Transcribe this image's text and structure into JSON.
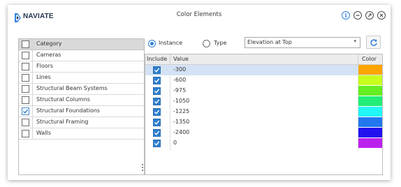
{
  "window": {
    "logo_text": "NAVIATE",
    "title": "Color Elements",
    "buttons": [
      "info",
      "minimize",
      "restore",
      "close"
    ]
  },
  "categories": {
    "header": "Category",
    "items": [
      {
        "label": "Cameras",
        "checked": false
      },
      {
        "label": "Floors",
        "checked": false
      },
      {
        "label": "Lines",
        "checked": false
      },
      {
        "label": "Structural Beam Systems",
        "checked": false
      },
      {
        "label": "Structural Columns",
        "checked": false
      },
      {
        "label": "Structural Foundations",
        "checked": true
      },
      {
        "label": "Structural Framing",
        "checked": false
      },
      {
        "label": "Walls",
        "checked": false
      }
    ]
  },
  "options": {
    "instance_label": "Instance",
    "instance_selected": true,
    "type_label": "Type",
    "type_selected": false,
    "parameter_select": "Elevation at Top",
    "refresh_icon": "refresh-icon"
  },
  "table": {
    "headers": {
      "include": "Include",
      "value": "Value",
      "color": "Color"
    },
    "rows": [
      {
        "value": "-300",
        "include": true,
        "color": "#FFA500",
        "selected": true
      },
      {
        "value": "-600",
        "include": true,
        "color": "#C8FF1E",
        "selected": false
      },
      {
        "value": "-975",
        "include": true,
        "color": "#66EE22",
        "selected": false
      },
      {
        "value": "-1050",
        "include": true,
        "color": "#22EE77",
        "selected": false
      },
      {
        "value": "-1225",
        "include": true,
        "color": "#22F5F5",
        "selected": false
      },
      {
        "value": "-1350",
        "include": true,
        "color": "#2277EE",
        "selected": false
      },
      {
        "value": "-2400",
        "include": true,
        "color": "#2210EE",
        "selected": false
      },
      {
        "value": "0",
        "include": true,
        "color": "#BB22EE",
        "selected": false
      }
    ]
  }
}
